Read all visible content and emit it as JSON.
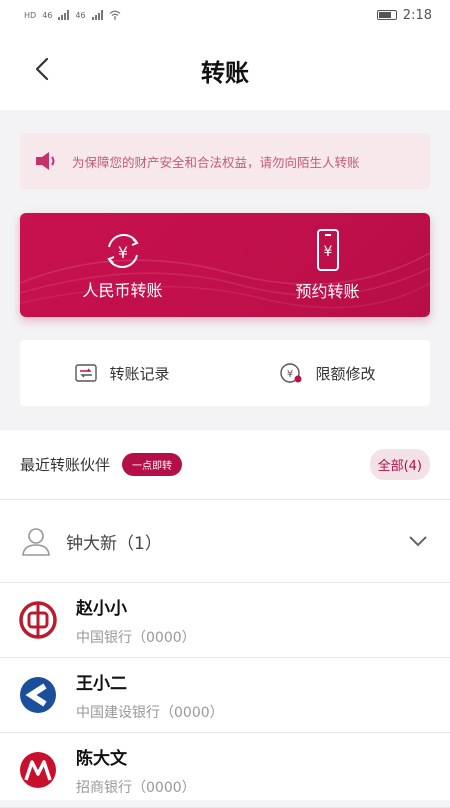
{
  "status_bar": {
    "left_labels": [
      "HD",
      "46",
      "46"
    ],
    "time": "2:18"
  },
  "header": {
    "title": "转账"
  },
  "notice": {
    "text": "为保障您的财产安全和合法权益，请勿向陌生人转账"
  },
  "banner": {
    "items": [
      {
        "label": "人民币转账",
        "icon": "yuan-exchange-icon"
      },
      {
        "label": "预约转账",
        "icon": "phone-yuan-icon"
      }
    ],
    "color": "#c0104b"
  },
  "quick_actions": [
    {
      "label": "转账记录",
      "icon": "transfer-record-icon"
    },
    {
      "label": "限额修改",
      "icon": "limit-edit-icon"
    }
  ],
  "recent": {
    "title": "最近转账伙伴",
    "pill": "一点即转",
    "all_label": "全部(4)"
  },
  "group": {
    "name": "钟大新（1）",
    "icon": "person-icon"
  },
  "contacts": [
    {
      "name": "赵小小",
      "bank": "中国银行（0000）",
      "logo": "bank-of-china-logo"
    },
    {
      "name": "王小二",
      "bank": "中国建设银行（0000）",
      "logo": "ccb-logo"
    },
    {
      "name": "陈大文",
      "bank": "招商银行（0000）",
      "logo": "cmb-logo"
    }
  ]
}
